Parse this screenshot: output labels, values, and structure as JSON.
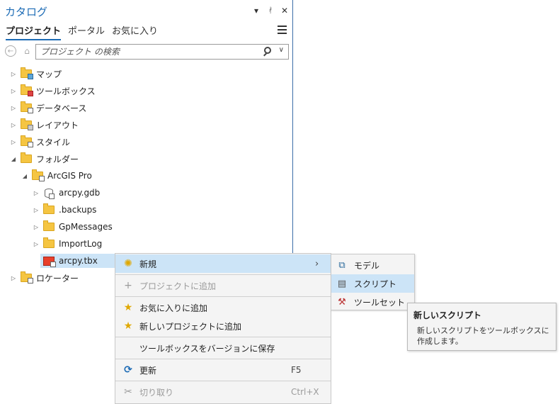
{
  "pane": {
    "title": "カタログ",
    "controls": {
      "dropdown": "▾",
      "pin": "📌",
      "close": "✕"
    },
    "tabs": [
      {
        "label": "プロジェクト",
        "active": true
      },
      {
        "label": "ポータル",
        "active": false
      },
      {
        "label": "お気に入り",
        "active": false
      }
    ]
  },
  "search": {
    "placeholder": "プロジェクト の検索",
    "value": ""
  },
  "tree": [
    {
      "label": "マップ",
      "expanded": false,
      "icon": "map-folder-icon"
    },
    {
      "label": "ツールボックス",
      "expanded": false,
      "icon": "toolbox-folder-icon"
    },
    {
      "label": "データベース",
      "expanded": false,
      "icon": "database-folder-icon"
    },
    {
      "label": "レイアウト",
      "expanded": false,
      "icon": "layout-folder-icon"
    },
    {
      "label": "スタイル",
      "expanded": false,
      "icon": "style-folder-icon"
    },
    {
      "label": "フォルダー",
      "expanded": true,
      "icon": "folder-connections-icon"
    },
    {
      "label": "ArcGIS Pro",
      "expanded": true,
      "icon": "home-folder-icon"
    },
    {
      "label": "arcpy.gdb",
      "expanded": false,
      "icon": "geodatabase-icon"
    },
    {
      "label": ".backups",
      "expanded": false,
      "icon": "folder-icon"
    },
    {
      "label": "GpMessages",
      "expanded": false,
      "icon": "folder-icon"
    },
    {
      "label": "ImportLog",
      "expanded": false,
      "icon": "folder-icon"
    },
    {
      "label": "arcpy.tbx",
      "expanded": null,
      "icon": "toolbox-icon",
      "selected": true
    },
    {
      "label": "ロケーター",
      "expanded": false,
      "icon": "locator-folder-icon"
    }
  ],
  "context_menu": {
    "new": {
      "label": "新規",
      "icon": "new-icon"
    },
    "add_to_project": {
      "label": "プロジェクトに追加",
      "icon": "plus-icon"
    },
    "add_to_favorites": {
      "label": "お気に入りに追加",
      "icon": "star-icon"
    },
    "add_to_new_projects": {
      "label": "新しいプロジェクトに追加",
      "icon": "star-plus-icon"
    },
    "save_as_version": {
      "label": "ツールボックスをバージョンに保存"
    },
    "refresh": {
      "label": "更新",
      "shortcut": "F5",
      "icon": "refresh-icon"
    },
    "cut": {
      "label": "切り取り",
      "shortcut": "Ctrl+X",
      "icon": "scissors-icon"
    }
  },
  "submenu": [
    {
      "label": "モデル",
      "icon": "model-icon"
    },
    {
      "label": "スクリプト",
      "icon": "script-icon",
      "highlighted": true
    },
    {
      "label": "ツールセット",
      "icon": "toolset-icon"
    }
  ],
  "tooltip": {
    "title": "新しいスクリプト",
    "body": "新しいスクリプトをツールボックスに作成します。"
  },
  "colors": {
    "accent": "#1c6bb5",
    "highlight": "#cce4f7",
    "menu_bg": "#f4f4f4"
  }
}
